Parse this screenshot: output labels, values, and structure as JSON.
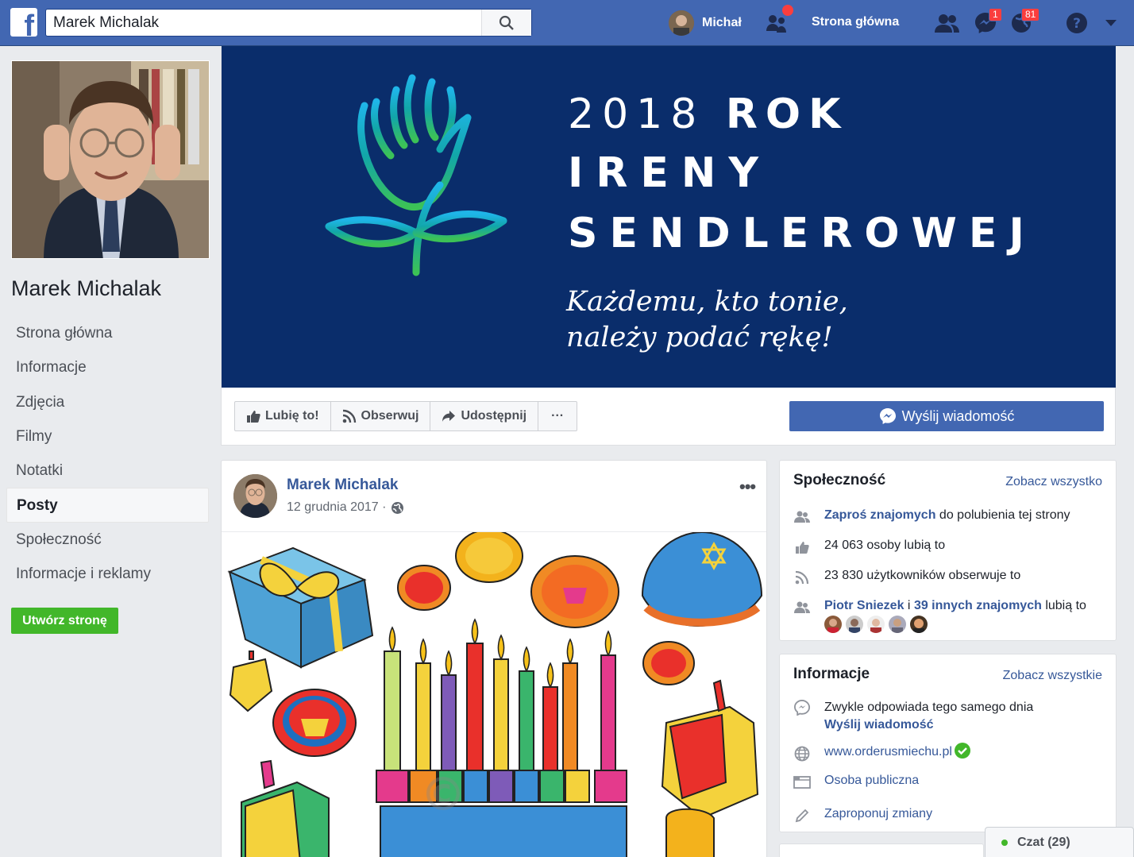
{
  "topbar": {
    "search_value": "Marek Michalak",
    "user_name": "Michał",
    "home_link": "Strona główna",
    "messages_badge": "1",
    "notifications_badge": "81"
  },
  "sidebar": {
    "page_name": "Marek Michalak",
    "items": [
      {
        "label": "Strona główna"
      },
      {
        "label": "Informacje"
      },
      {
        "label": "Zdjęcia"
      },
      {
        "label": "Filmy"
      },
      {
        "label": "Notatki"
      },
      {
        "label": "Posty"
      },
      {
        "label": "Społeczność"
      },
      {
        "label": "Informacje i reklamy"
      }
    ],
    "active_index": 5,
    "create_page_label": "Utwórz stronę"
  },
  "cover": {
    "line1_year": "2018",
    "line1_word": "ROK",
    "line2": "IRENY",
    "line3": "SENDLEROWEJ",
    "tagline1": "Każdemu, kto tonie,",
    "tagline2": "należy podać rękę!"
  },
  "actions": {
    "like": "Lubię to!",
    "follow": "Obserwuj",
    "share": "Udostępnij",
    "more": "···",
    "send_message": "Wyślij wiadomość"
  },
  "post": {
    "author": "Marek Michalak",
    "date": "12 grudnia 2017 ·"
  },
  "community": {
    "title": "Społeczność",
    "see_all": "Zobacz wszystko",
    "invite_link": "Zaproś znajomych",
    "invite_rest": " do polubienia tej strony",
    "likes": "24 063 osoby lubią to",
    "followers": "23 830 użytkowników obserwuje to",
    "friend1": "Piotr Sniezek",
    "friend_and": " i ",
    "friend_others": "39 innych znajomych",
    "friend_rest": " lubią to"
  },
  "info": {
    "title": "Informacje",
    "see_all": "Zobacz wszystkie",
    "response": "Zwykle odpowiada tego samego dnia",
    "send_message": "Wyślij wiadomość",
    "website": "www.orderusmiechu.pl",
    "category": "Osoba publiczna",
    "suggest": "Zaproponuj zmiany"
  },
  "chat": {
    "label": "Czat (29)"
  },
  "colors": {
    "brand": "#4267b2",
    "link": "#365899",
    "green": "#42b72a",
    "cover_bg": "#0a2d6b"
  }
}
